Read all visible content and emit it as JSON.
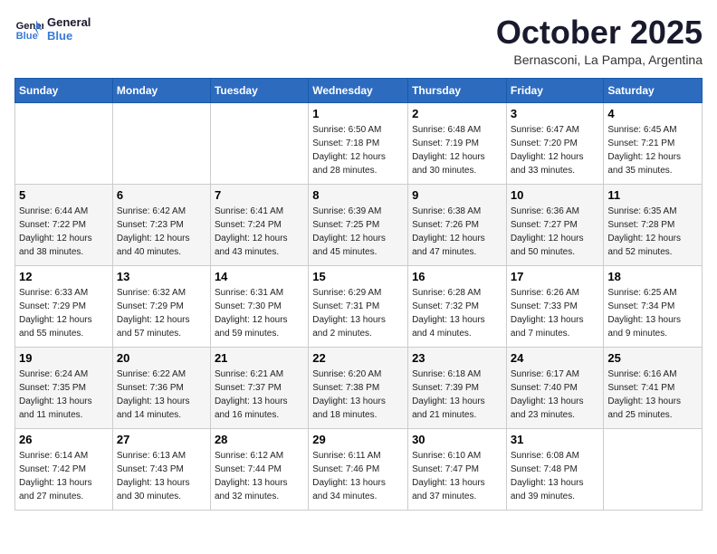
{
  "header": {
    "logo_line1": "General",
    "logo_line2": "Blue",
    "month": "October 2025",
    "location": "Bernasconi, La Pampa, Argentina"
  },
  "weekdays": [
    "Sunday",
    "Monday",
    "Tuesday",
    "Wednesday",
    "Thursday",
    "Friday",
    "Saturday"
  ],
  "weeks": [
    [
      {
        "day": "",
        "info": ""
      },
      {
        "day": "",
        "info": ""
      },
      {
        "day": "",
        "info": ""
      },
      {
        "day": "1",
        "info": "Sunrise: 6:50 AM\nSunset: 7:18 PM\nDaylight: 12 hours\nand 28 minutes."
      },
      {
        "day": "2",
        "info": "Sunrise: 6:48 AM\nSunset: 7:19 PM\nDaylight: 12 hours\nand 30 minutes."
      },
      {
        "day": "3",
        "info": "Sunrise: 6:47 AM\nSunset: 7:20 PM\nDaylight: 12 hours\nand 33 minutes."
      },
      {
        "day": "4",
        "info": "Sunrise: 6:45 AM\nSunset: 7:21 PM\nDaylight: 12 hours\nand 35 minutes."
      }
    ],
    [
      {
        "day": "5",
        "info": "Sunrise: 6:44 AM\nSunset: 7:22 PM\nDaylight: 12 hours\nand 38 minutes."
      },
      {
        "day": "6",
        "info": "Sunrise: 6:42 AM\nSunset: 7:23 PM\nDaylight: 12 hours\nand 40 minutes."
      },
      {
        "day": "7",
        "info": "Sunrise: 6:41 AM\nSunset: 7:24 PM\nDaylight: 12 hours\nand 43 minutes."
      },
      {
        "day": "8",
        "info": "Sunrise: 6:39 AM\nSunset: 7:25 PM\nDaylight: 12 hours\nand 45 minutes."
      },
      {
        "day": "9",
        "info": "Sunrise: 6:38 AM\nSunset: 7:26 PM\nDaylight: 12 hours\nand 47 minutes."
      },
      {
        "day": "10",
        "info": "Sunrise: 6:36 AM\nSunset: 7:27 PM\nDaylight: 12 hours\nand 50 minutes."
      },
      {
        "day": "11",
        "info": "Sunrise: 6:35 AM\nSunset: 7:28 PM\nDaylight: 12 hours\nand 52 minutes."
      }
    ],
    [
      {
        "day": "12",
        "info": "Sunrise: 6:33 AM\nSunset: 7:29 PM\nDaylight: 12 hours\nand 55 minutes."
      },
      {
        "day": "13",
        "info": "Sunrise: 6:32 AM\nSunset: 7:29 PM\nDaylight: 12 hours\nand 57 minutes."
      },
      {
        "day": "14",
        "info": "Sunrise: 6:31 AM\nSunset: 7:30 PM\nDaylight: 12 hours\nand 59 minutes."
      },
      {
        "day": "15",
        "info": "Sunrise: 6:29 AM\nSunset: 7:31 PM\nDaylight: 13 hours\nand 2 minutes."
      },
      {
        "day": "16",
        "info": "Sunrise: 6:28 AM\nSunset: 7:32 PM\nDaylight: 13 hours\nand 4 minutes."
      },
      {
        "day": "17",
        "info": "Sunrise: 6:26 AM\nSunset: 7:33 PM\nDaylight: 13 hours\nand 7 minutes."
      },
      {
        "day": "18",
        "info": "Sunrise: 6:25 AM\nSunset: 7:34 PM\nDaylight: 13 hours\nand 9 minutes."
      }
    ],
    [
      {
        "day": "19",
        "info": "Sunrise: 6:24 AM\nSunset: 7:35 PM\nDaylight: 13 hours\nand 11 minutes."
      },
      {
        "day": "20",
        "info": "Sunrise: 6:22 AM\nSunset: 7:36 PM\nDaylight: 13 hours\nand 14 minutes."
      },
      {
        "day": "21",
        "info": "Sunrise: 6:21 AM\nSunset: 7:37 PM\nDaylight: 13 hours\nand 16 minutes."
      },
      {
        "day": "22",
        "info": "Sunrise: 6:20 AM\nSunset: 7:38 PM\nDaylight: 13 hours\nand 18 minutes."
      },
      {
        "day": "23",
        "info": "Sunrise: 6:18 AM\nSunset: 7:39 PM\nDaylight: 13 hours\nand 21 minutes."
      },
      {
        "day": "24",
        "info": "Sunrise: 6:17 AM\nSunset: 7:40 PM\nDaylight: 13 hours\nand 23 minutes."
      },
      {
        "day": "25",
        "info": "Sunrise: 6:16 AM\nSunset: 7:41 PM\nDaylight: 13 hours\nand 25 minutes."
      }
    ],
    [
      {
        "day": "26",
        "info": "Sunrise: 6:14 AM\nSunset: 7:42 PM\nDaylight: 13 hours\nand 27 minutes."
      },
      {
        "day": "27",
        "info": "Sunrise: 6:13 AM\nSunset: 7:43 PM\nDaylight: 13 hours\nand 30 minutes."
      },
      {
        "day": "28",
        "info": "Sunrise: 6:12 AM\nSunset: 7:44 PM\nDaylight: 13 hours\nand 32 minutes."
      },
      {
        "day": "29",
        "info": "Sunrise: 6:11 AM\nSunset: 7:46 PM\nDaylight: 13 hours\nand 34 minutes."
      },
      {
        "day": "30",
        "info": "Sunrise: 6:10 AM\nSunset: 7:47 PM\nDaylight: 13 hours\nand 37 minutes."
      },
      {
        "day": "31",
        "info": "Sunrise: 6:08 AM\nSunset: 7:48 PM\nDaylight: 13 hours\nand 39 minutes."
      },
      {
        "day": "",
        "info": ""
      }
    ]
  ]
}
